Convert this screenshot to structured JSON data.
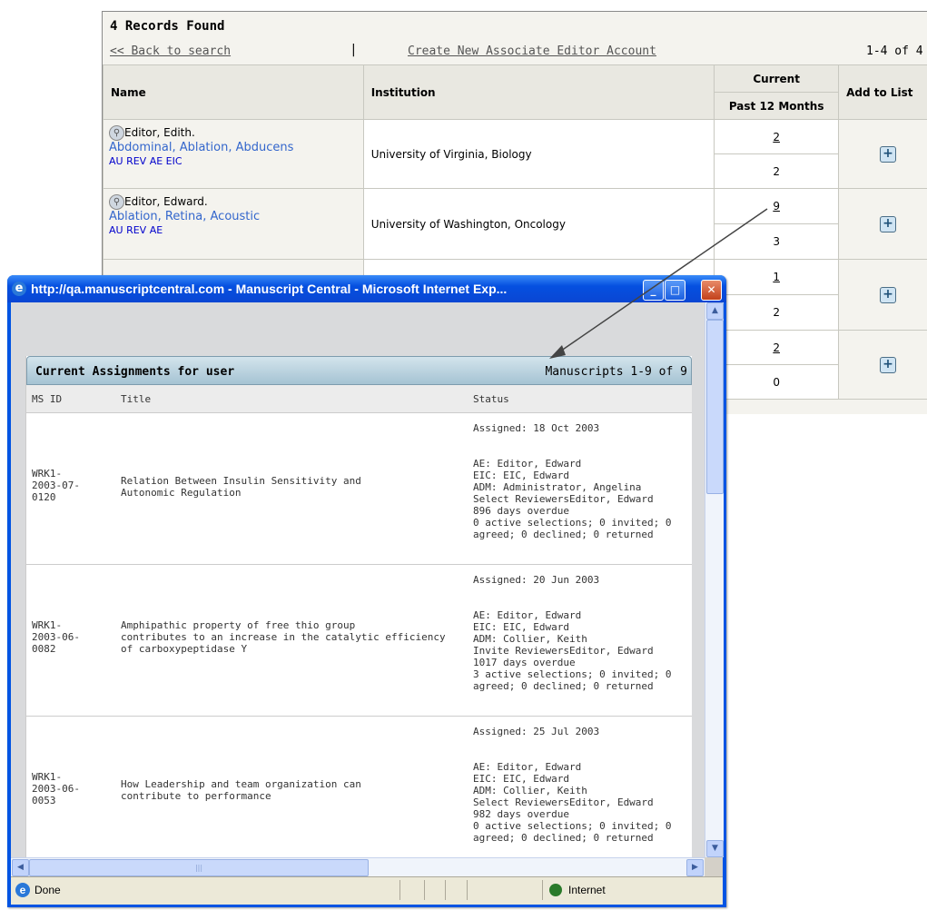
{
  "results": {
    "records_found": "4 Records Found",
    "back_link": "<< Back to search",
    "separator": "|",
    "create_link": "Create New Associate Editor Account",
    "range": "1-4 of 4",
    "headers": {
      "name": "Name",
      "institution": "Institution",
      "current": "Current",
      "past12": "Past 12 Months",
      "add_to_list": "Add to List"
    },
    "rows": [
      {
        "name": "Editor, Edith.",
        "keywords": "Abdominal, Ablation, Abducens",
        "roles": "AU REV AE EIC",
        "institution": "University of Virginia, Biology",
        "current": "2",
        "past12": "2"
      },
      {
        "name": "Editor, Edward.",
        "keywords": "Ablation, Retina, Acoustic",
        "roles": "AU REV AE",
        "institution": "University of Washington, Oncology",
        "current": "9",
        "past12": "3"
      },
      {
        "current": "1",
        "past12": "2"
      },
      {
        "current": "2",
        "past12": "0"
      }
    ]
  },
  "popup": {
    "window_title": "http://qa.manuscriptcentral.com - Manuscript Central - Microsoft Internet Exp...",
    "panel_title": "Current Assignments for user",
    "manuscripts_range": "Manuscripts 1-9 of 9",
    "columns": {
      "ms_id": "MS ID",
      "title": "Title",
      "status": "Status"
    },
    "assignments": [
      {
        "id": [
          "WRK1-",
          "2003-07-",
          "0120"
        ],
        "title": [
          "Relation Between Insulin Sensitivity and",
          "Autonomic Regulation"
        ],
        "assigned": "Assigned: 18 Oct 2003",
        "status": [
          "AE: Editor, Edward",
          "EIC: EIC, Edward",
          "ADM: Administrator, Angelina",
          "Select ReviewersEditor, Edward",
          "896 days overdue",
          "0 active selections; 0 invited; 0",
          "agreed; 0 declined; 0 returned"
        ]
      },
      {
        "id": [
          "WRK1-",
          "2003-06-",
          "0082"
        ],
        "title": [
          "Amphipathic property of free thio group",
          "contributes to an increase in the catalytic efficiency",
          "of carboxypeptidase Y"
        ],
        "assigned": "Assigned: 20 Jun 2003",
        "status": [
          "AE: Editor, Edward",
          "EIC: EIC, Edward",
          "ADM: Collier, Keith",
          "Invite ReviewersEditor, Edward",
          "1017 days overdue",
          "3 active selections; 0 invited; 0",
          "agreed; 0 declined; 0 returned"
        ]
      },
      {
        "id": [
          "WRK1-",
          "2003-06-",
          "0053"
        ],
        "title": [
          "How Leadership and team organization can",
          "contribute to performance"
        ],
        "assigned": "Assigned: 25 Jul 2003",
        "status": [
          "AE: Editor, Edward",
          "EIC: EIC, Edward",
          "ADM: Collier, Keith",
          "Select ReviewersEditor, Edward",
          "982 days overdue",
          "0 active selections; 0 invited; 0",
          "agreed; 0 declined; 0 returned"
        ]
      }
    ],
    "status_bar": {
      "left": "Done",
      "zone": "Internet"
    }
  }
}
